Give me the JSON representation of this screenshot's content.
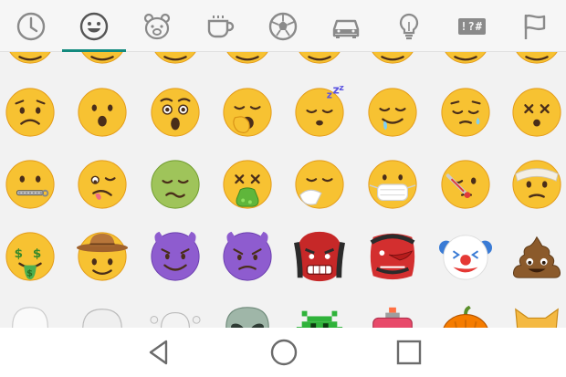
{
  "colors": {
    "accent": "#138a7e",
    "icon_gray": "#8a8a8a",
    "face_yellow": "#f7c232",
    "nav_icon": "#6b6b6b"
  },
  "tabs": [
    {
      "icon": "clock-icon",
      "name": "recent"
    },
    {
      "icon": "smiley-icon",
      "name": "smileys",
      "selected": true
    },
    {
      "icon": "bear-icon",
      "name": "animals"
    },
    {
      "icon": "cup-icon",
      "name": "food"
    },
    {
      "icon": "soccer-ball-icon",
      "name": "activity"
    },
    {
      "icon": "car-icon",
      "name": "travel"
    },
    {
      "icon": "lightbulb-icon",
      "name": "objects"
    },
    {
      "icon": "symbols-icon",
      "name": "symbols",
      "label": "!?#"
    },
    {
      "icon": "flag-icon",
      "name": "flags"
    }
  ],
  "emoji_rows": [
    [
      "worried-face",
      "hushed-face",
      "astonished-face",
      "yawning-face",
      "sleeping-face",
      "drooling-face",
      "sleepy-face",
      "dizzy-face"
    ],
    [
      "zipper-mouth-face",
      "woozy-face",
      "nauseated-face",
      "vomiting-face",
      "sneezing-face",
      "face-with-medical-mask",
      "face-with-thermometer",
      "face-with-head-bandage"
    ],
    [
      "money-mouth-face",
      "cowboy-hat-face",
      "smiling-face-with-horns",
      "angry-face-with-horns",
      "ogre",
      "goblin",
      "clown-face",
      "pile-of-poo"
    ],
    [
      "ghost",
      "skull",
      "skull-and-crossbones",
      "alien",
      "alien-monster",
      "robot",
      "jack-o-lantern",
      "cat-face"
    ]
  ],
  "navigation": [
    {
      "icon": "back-triangle-icon"
    },
    {
      "icon": "home-circle-icon"
    },
    {
      "icon": "recents-square-icon"
    }
  ]
}
